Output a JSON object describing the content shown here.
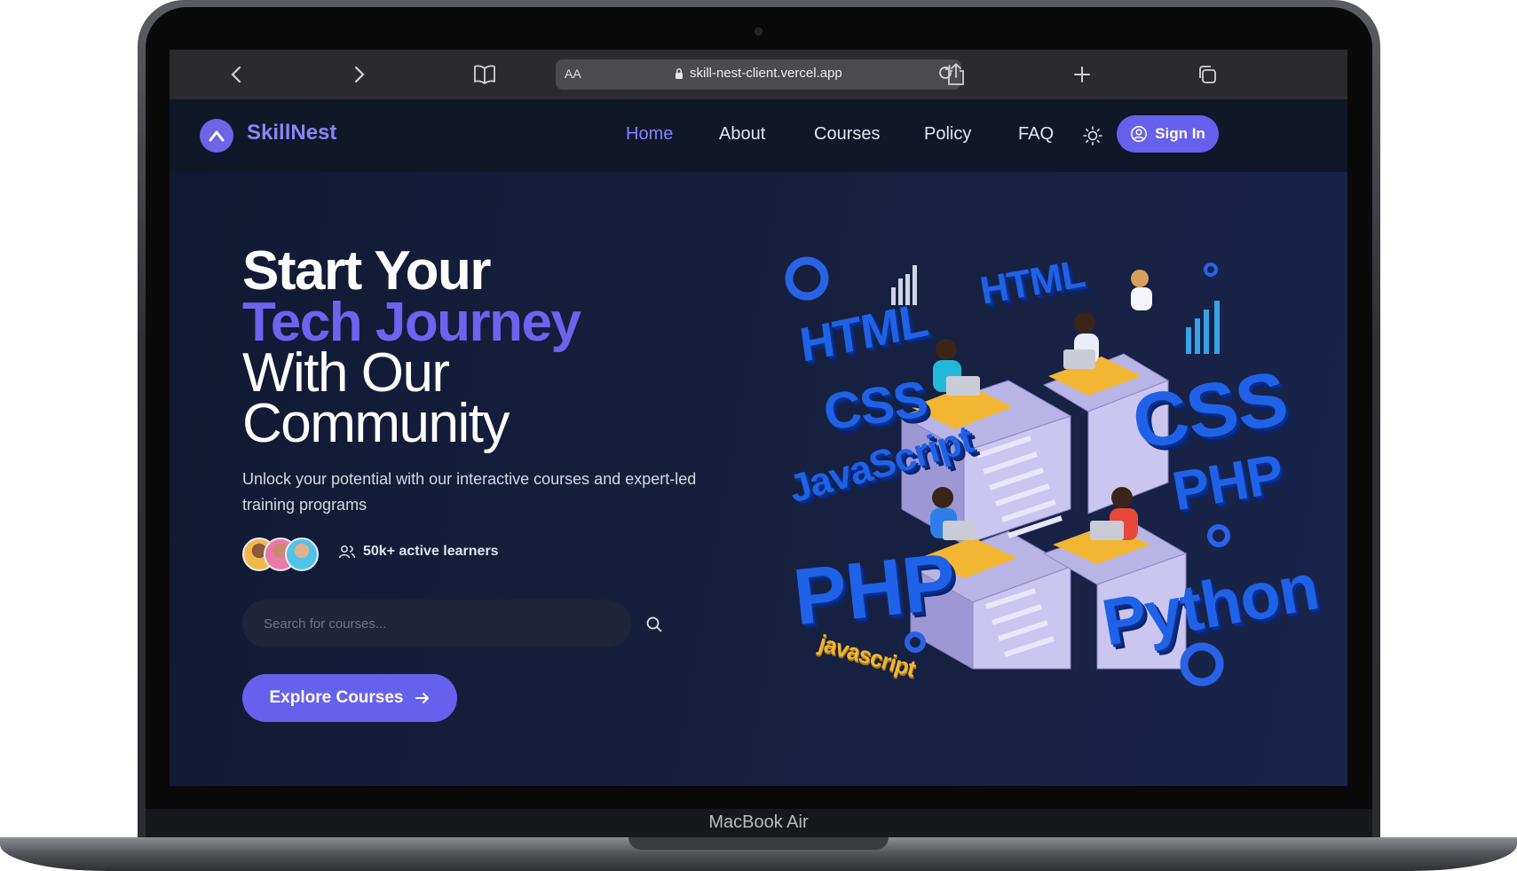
{
  "device": {
    "label": "MacBook Air"
  },
  "browser": {
    "text_size_label": "AA",
    "url": "skill-nest-client.vercel.app"
  },
  "header": {
    "brand": "SkillNest",
    "nav": [
      {
        "label": "Home",
        "active": true
      },
      {
        "label": "About"
      },
      {
        "label": "Courses"
      },
      {
        "label": "Policy"
      },
      {
        "label": "FAQ"
      }
    ],
    "signin_label": "Sign In"
  },
  "hero": {
    "title_line1": "Start Your",
    "title_line2": "Tech Journey",
    "title_line3": "With Our",
    "title_line4": "Community",
    "subtitle": "Unlock your potential with our interactive courses and expert-led training programs",
    "learners_label": "50k+ active learners",
    "search_placeholder": "Search for courses...",
    "cta_label": "Explore Courses"
  },
  "illustration": {
    "labels": [
      "HTML",
      "HTML",
      "CSS",
      "CSS",
      "JavaScript",
      "PHP",
      "PHP",
      "Python",
      "javascript"
    ]
  },
  "colors": {
    "accent": "#6561ec",
    "accent_text": "#6c63ee",
    "background": "#111a33",
    "header_bg": "#0f1729",
    "tech_blue": "#1f62e8"
  }
}
